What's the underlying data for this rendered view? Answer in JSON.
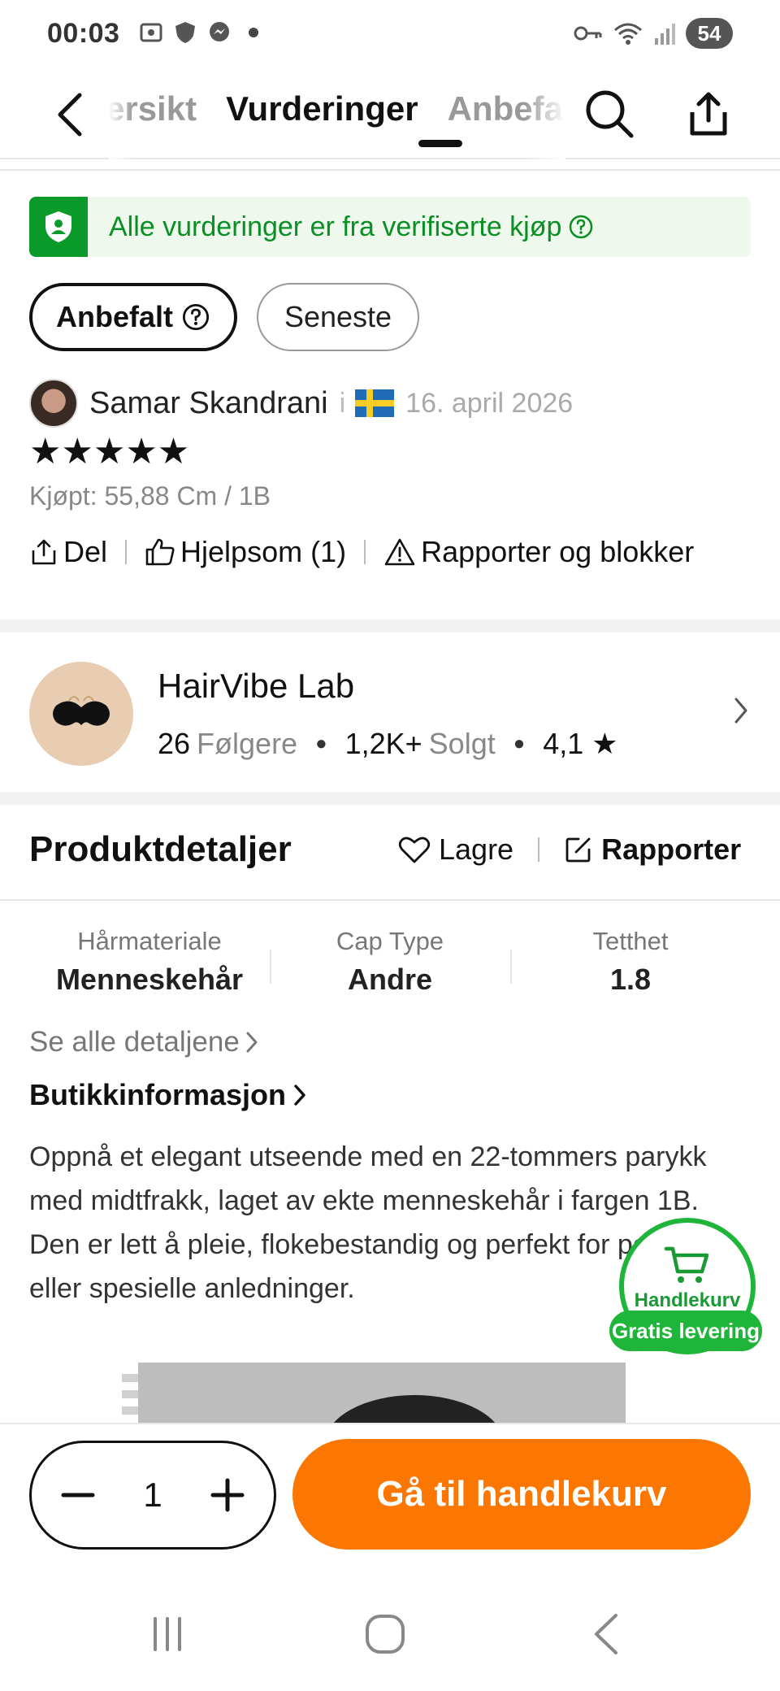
{
  "status_bar": {
    "time": "00:03",
    "battery": "54",
    "icons_left": [
      "screenshot-icon",
      "shield-app-icon",
      "messenger-icon"
    ],
    "icons_right": [
      "key-icon",
      "wifi-icon",
      "signal-icon"
    ]
  },
  "header": {
    "tabs": [
      {
        "label": "Oversikt",
        "visible_text": "ersikt"
      },
      {
        "label": "Vurderinger",
        "active": true
      },
      {
        "label": "Anbefalt",
        "visible_text": "Anbefa"
      }
    ]
  },
  "verified_banner": {
    "text": "Alle vurderinger er fra verifiserte kjøp",
    "color": "#0a9a29"
  },
  "sort_chips": {
    "recommended": "Anbefalt",
    "newest": "Seneste"
  },
  "review": {
    "reviewer": "Samar Skandrani",
    "separator": "i",
    "country_flag": "Sweden",
    "date": "16. april 2026",
    "rating": 5,
    "stars": "★★★★★",
    "purchased": "Kjøpt: 55,88 Cm / 1B",
    "actions": {
      "share": "Del",
      "helpful": "Hjelpsom (1)",
      "report": "Rapporter og blokker"
    }
  },
  "store": {
    "name": "HairVibe Lab",
    "followers_count": "26",
    "followers_label": "Følgere",
    "sold_count": "1,2K+",
    "sold_label": "Solgt",
    "rating": "4,1",
    "star": "★"
  },
  "product_details": {
    "title": "Produktdetaljer",
    "save": "Lagre",
    "report": "Rapporter",
    "attributes": [
      {
        "label": "Hårmateriale",
        "value": "Menneskehår"
      },
      {
        "label": "Cap Type",
        "value": "Andre"
      },
      {
        "label": "Tetthet",
        "value": "1.8"
      }
    ],
    "see_all": "Se alle detaljene",
    "shop_info": "Butikkinformasjon",
    "description": "Oppnå et elegant utseende med en 22-tommers parykk med midtfrakk, laget av ekte menneskehår i fargen 1B. Den er lett å pleie, flokebestandig og perfekt for pendling eller spesielle anledninger."
  },
  "floating_cart": {
    "label": "Handlekurv",
    "badge": "Gratis levering",
    "color": "#1eb53a"
  },
  "bottom_bar": {
    "quantity": "1",
    "cart_button": "Gå til handlekurv",
    "accent": "#fb7701"
  },
  "nav_bar": {
    "buttons": [
      "recents-icon",
      "home-icon",
      "back-icon"
    ]
  }
}
